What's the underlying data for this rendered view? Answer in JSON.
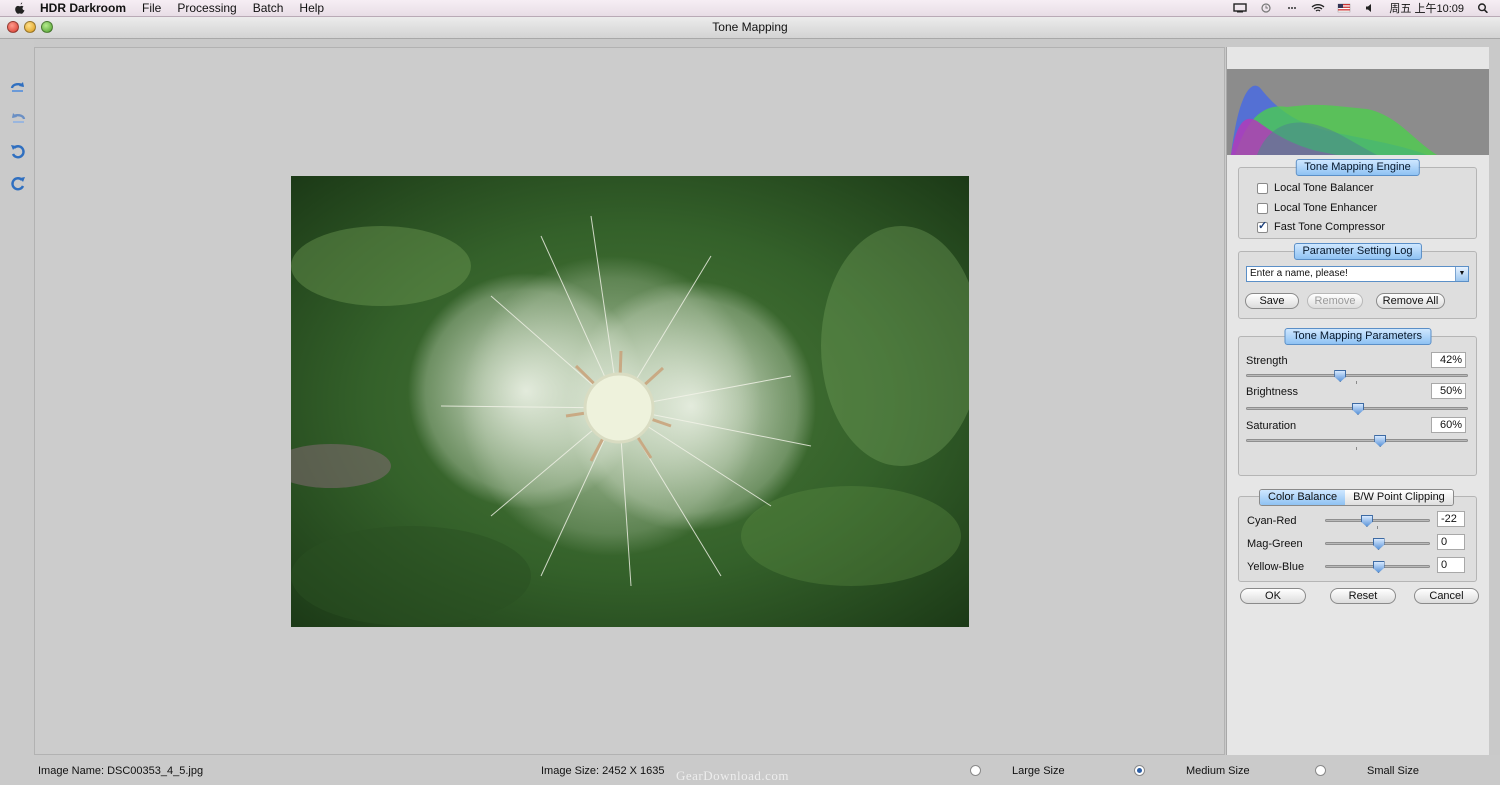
{
  "menubar": {
    "app_name": "HDR Darkroom",
    "menus": [
      "File",
      "Processing",
      "Batch",
      "Help"
    ],
    "clock": "周五 上午10:09",
    "status_icons": [
      "display-icon",
      "time-machine-icon",
      "bluetooth-icon",
      "wifi-icon",
      "flag-icon",
      "volume-icon",
      "spotlight-icon"
    ]
  },
  "window": {
    "title": "Tone Mapping"
  },
  "toolbar": {
    "tools": [
      "rotate-ccw-tool-icon",
      "rotate-cw-tool-icon",
      "undo-icon",
      "redo-icon"
    ]
  },
  "engine": {
    "title": "Tone Mapping Engine",
    "options": [
      {
        "label": "Local Tone Balancer",
        "checked": false
      },
      {
        "label": "Local Tone Enhancer",
        "checked": false
      },
      {
        "label": "Fast Tone Compressor",
        "checked": true
      }
    ]
  },
  "log": {
    "title": "Parameter Setting Log",
    "name_value": "Enter a name, please!",
    "save": "Save",
    "remove": "Remove",
    "remove_all": "Remove All"
  },
  "params": {
    "title": "Tone Mapping Parameters",
    "items": [
      {
        "label": "Strength",
        "value_text": "42%",
        "value": 0.42
      },
      {
        "label": "Brightness",
        "value_text": "50%",
        "value": 0.5
      },
      {
        "label": "Saturation",
        "value_text": "60%",
        "value": 0.6
      }
    ]
  },
  "color": {
    "tabs": [
      "Color Balance",
      "B/W Point Clipping"
    ],
    "active_tab": 0,
    "items": [
      {
        "label": "Cyan-Red",
        "value_text": "-22",
        "value": -22
      },
      {
        "label": "Mag-Green",
        "value_text": "0",
        "value": 0
      },
      {
        "label": "Yellow-Blue",
        "value_text": "0",
        "value": 0
      }
    ]
  },
  "actions": {
    "ok": "OK",
    "reset": "Reset",
    "cancel": "Cancel"
  },
  "status": {
    "image_name": "Image Name: DSC00353_4_5.jpg",
    "image_size": "Image Size: 2452 X 1635",
    "watermark": "GearDownload.com",
    "sizes": [
      {
        "label": "Large Size",
        "selected": false
      },
      {
        "label": "Medium Size",
        "selected": true
      },
      {
        "label": "Small Size",
        "selected": false
      }
    ]
  },
  "colors": {
    "accent": "#8fc2f3",
    "hist_blue": "#4a6be0",
    "hist_green": "#4ad24a",
    "hist_magenta": "#b23bb8"
  }
}
